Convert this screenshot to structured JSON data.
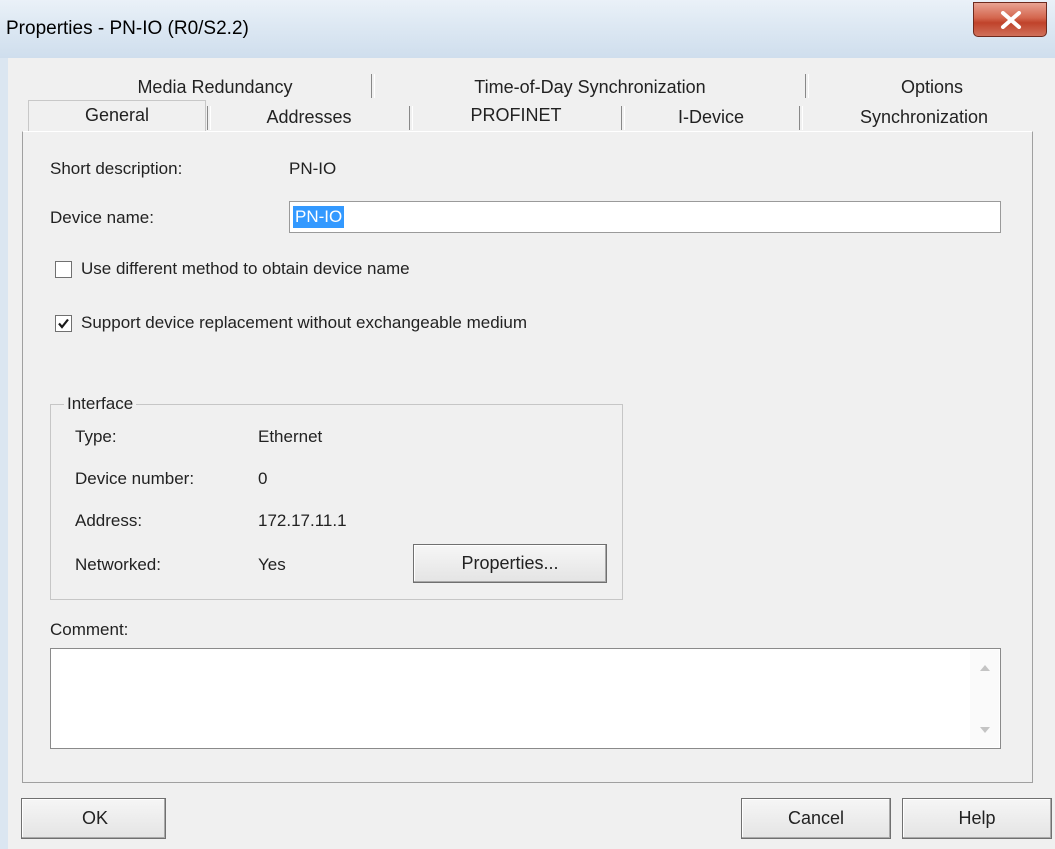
{
  "window": {
    "title": "Properties - PN-IO (R0/S2.2)",
    "close_icon": "close-x-icon",
    "accent_close": "#c94a33"
  },
  "tabs": {
    "row1": [
      {
        "label": "Media Redundancy"
      },
      {
        "label": "Time-of-Day Synchronization"
      },
      {
        "label": "Options"
      }
    ],
    "row2": [
      {
        "label": "General",
        "active": true
      },
      {
        "label": "Addresses"
      },
      {
        "label": "PROFINET"
      },
      {
        "label": "I-Device"
      },
      {
        "label": "Synchronization"
      }
    ]
  },
  "general": {
    "short_description_label": "Short description:",
    "short_description_value": "PN-IO",
    "device_name_label": "Device name:",
    "device_name_value": "PN-IO",
    "use_different_method_label": "Use different method to obtain device name",
    "use_different_method_checked": false,
    "support_replacement_label": "Support device replacement without exchangeable medium",
    "support_replacement_checked": true
  },
  "interface": {
    "legend": "Interface",
    "type_label": "Type:",
    "type_value": "Ethernet",
    "device_number_label": "Device number:",
    "device_number_value": "0",
    "address_label": "Address:",
    "address_value": "172.17.11.1",
    "networked_label": "Networked:",
    "networked_value": "Yes",
    "properties_button": "Properties..."
  },
  "comment": {
    "label": "Comment:",
    "value": ""
  },
  "footer": {
    "ok": "OK",
    "cancel": "Cancel",
    "help": "Help"
  }
}
